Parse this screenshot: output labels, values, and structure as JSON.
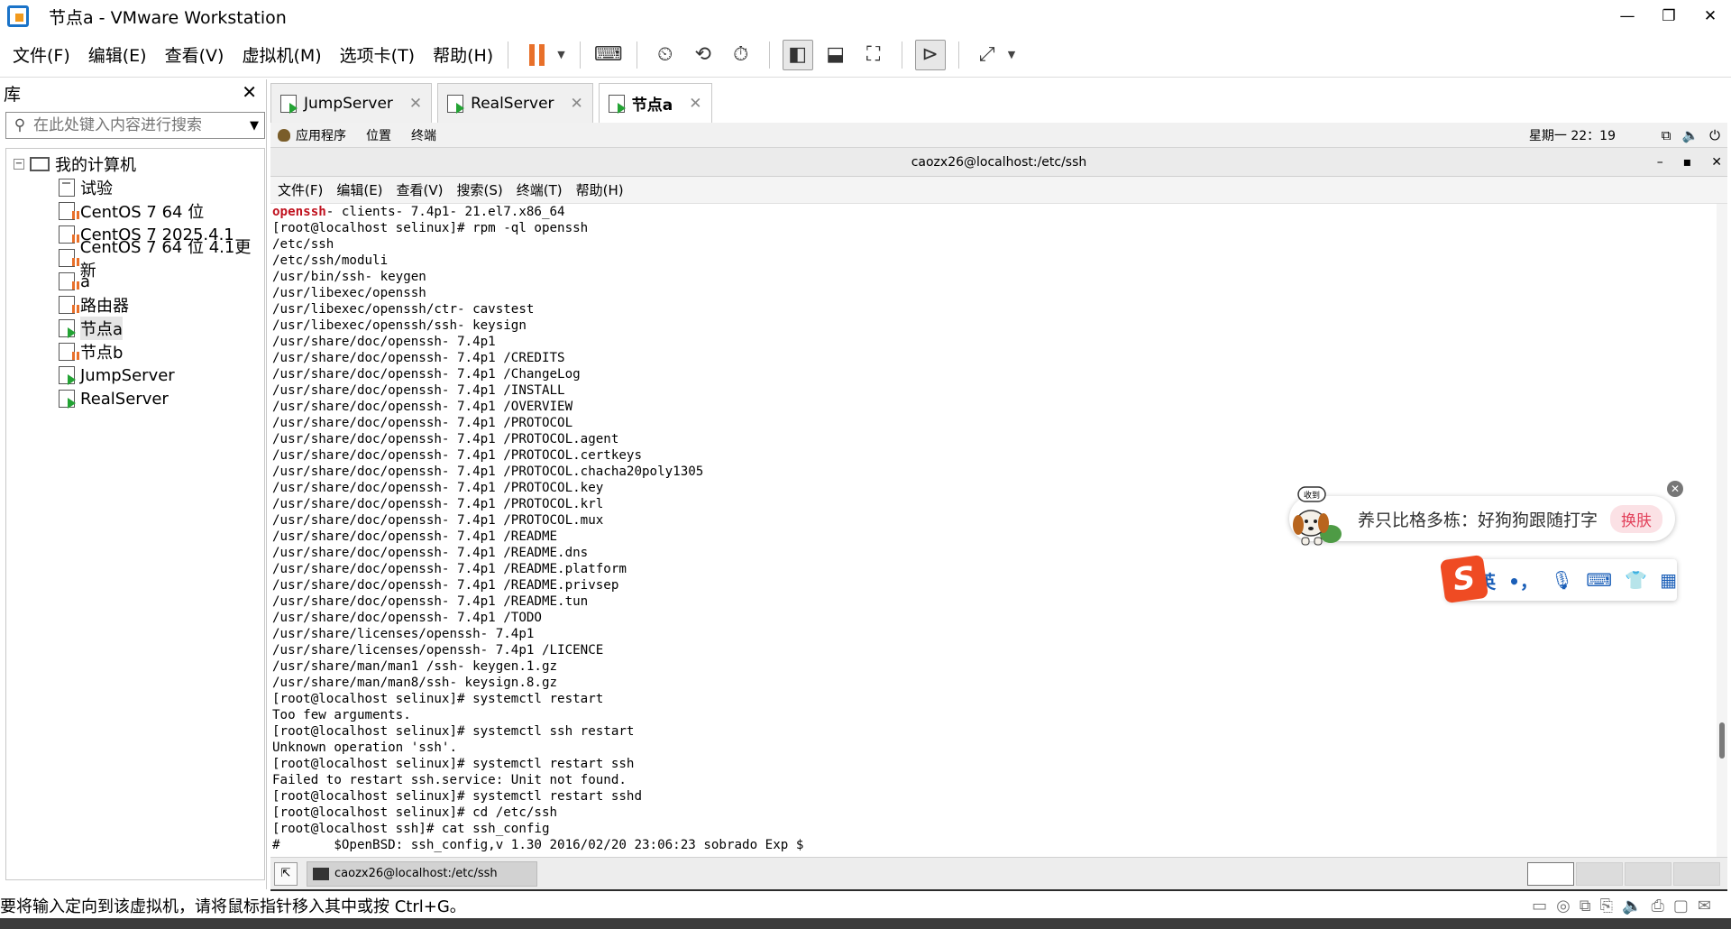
{
  "window": {
    "title": "节点a - VMware Workstation",
    "controls": [
      "—",
      "❐",
      "✕"
    ]
  },
  "menu": {
    "items": [
      "文件(F)",
      "编辑(E)",
      "查看(V)",
      "虚拟机(M)",
      "选项卡(T)",
      "帮助(H)"
    ]
  },
  "library": {
    "title": "库",
    "close": "✕",
    "search_placeholder": "在此处键入内容进行搜索",
    "root": "我的计算机",
    "items": [
      {
        "label": "试验",
        "state": "plain"
      },
      {
        "label": "CentOS 7 64 位",
        "state": "paused"
      },
      {
        "label": "CentOS 7 2025.4.1",
        "state": "paused"
      },
      {
        "label": "CentOS 7 64 位 4.1更新",
        "state": "paused"
      },
      {
        "label": "a",
        "state": "paused"
      },
      {
        "label": "路由器",
        "state": "paused"
      },
      {
        "label": "节点a",
        "state": "running"
      },
      {
        "label": "节点b",
        "state": "paused"
      },
      {
        "label": "JumpServer",
        "state": "running"
      },
      {
        "label": "RealServer",
        "state": "running"
      }
    ]
  },
  "tabs": [
    {
      "label": "JumpServer",
      "close": "✕"
    },
    {
      "label": "RealServer",
      "close": "✕"
    },
    {
      "label": "节点a",
      "close": "✕"
    }
  ],
  "gnome": {
    "apps": "应用程序",
    "places": "位置",
    "terminal": "终端",
    "clock": "星期一 22：19",
    "sys_icons": [
      "network-icon",
      "volume-icon",
      "power-icon"
    ]
  },
  "terminal": {
    "title": "caozx26@localhost:/etc/ssh",
    "controls": [
      "–",
      "▪",
      "✕"
    ],
    "menu": [
      "文件(F)",
      "编辑(E)",
      "查看(V)",
      "搜索(S)",
      "终端(T)",
      "帮助(H)"
    ],
    "first_line_highlight": "openssh",
    "first_line_rest": "- clients- 7.4p1- 21.el7.x86_64",
    "lines": [
      "[root@localhost selinux]# rpm -ql openssh",
      "/etc/ssh",
      "/etc/ssh/moduli",
      "/usr/bin/ssh- keygen",
      "/usr/libexec/openssh",
      "/usr/libexec/openssh/ctr- cavstest",
      "/usr/libexec/openssh/ssh- keysign",
      "/usr/share/doc/openssh- 7.4p1",
      "/usr/share/doc/openssh- 7.4p1 /CREDITS",
      "/usr/share/doc/openssh- 7.4p1 /ChangeLog",
      "/usr/share/doc/openssh- 7.4p1 /INSTALL",
      "/usr/share/doc/openssh- 7.4p1 /OVERVIEW",
      "/usr/share/doc/openssh- 7.4p1 /PROTOCOL",
      "/usr/share/doc/openssh- 7.4p1 /PROTOCOL.agent",
      "/usr/share/doc/openssh- 7.4p1 /PROTOCOL.certkeys",
      "/usr/share/doc/openssh- 7.4p1 /PROTOCOL.chacha20poly1305",
      "/usr/share/doc/openssh- 7.4p1 /PROTOCOL.key",
      "/usr/share/doc/openssh- 7.4p1 /PROTOCOL.krl",
      "/usr/share/doc/openssh- 7.4p1 /PROTOCOL.mux",
      "/usr/share/doc/openssh- 7.4p1 /README",
      "/usr/share/doc/openssh- 7.4p1 /README.dns",
      "/usr/share/doc/openssh- 7.4p1 /README.platform",
      "/usr/share/doc/openssh- 7.4p1 /README.privsep",
      "/usr/share/doc/openssh- 7.4p1 /README.tun",
      "/usr/share/doc/openssh- 7.4p1 /TODO",
      "/usr/share/licenses/openssh- 7.4p1",
      "/usr/share/licenses/openssh- 7.4p1 /LICENCE",
      "/usr/share/man/man1 /ssh- keygen.1.gz",
      "/usr/share/man/man8/ssh- keysign.8.gz",
      "[root@localhost selinux]# systemctl restart",
      "Too few arguments.",
      "[root@localhost selinux]# systemctl ssh restart",
      "Unknown operation 'ssh'.",
      "[root@localhost selinux]# systemctl restart ssh",
      "Failed to restart ssh.service: Unit not found.",
      "[root@localhost selinux]# systemctl restart sshd",
      "[root@localhost selinux]# cd /etc/ssh",
      "[root@localhost ssh]# cat ssh_config",
      "#       $OpenBSD: ssh_config,v 1.30 2016/02/20 23:06:23 sobrado Exp $"
    ]
  },
  "taskbar": {
    "task_label": "caozx26@localhost:/etc/ssh"
  },
  "ime": {
    "dog_badge": "收到",
    "message": "养只比格多栋：好狗狗跟随打字",
    "pill": "换肤",
    "logo": "S",
    "lang": "英",
    "punct": "•，"
  },
  "status": {
    "text": "要将输入定向到该虚拟机，请将鼠标指针移入其中或按 Ctrl+G。"
  },
  "colors": {
    "accent_orange": "#e8702a",
    "running_green": "#23a334",
    "highlight_red": "#c0121f",
    "ime_red": "#ef4b23"
  }
}
